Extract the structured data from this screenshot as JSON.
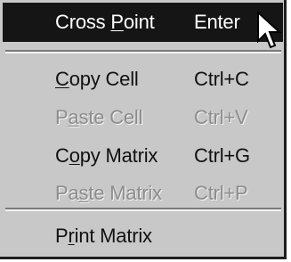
{
  "menu": {
    "items": [
      {
        "pre": "Cross ",
        "mnemonic": "P",
        "post": "oint",
        "accelerator": "Enter"
      },
      {
        "pre": "",
        "mnemonic": "C",
        "post": "opy Cell",
        "accelerator": "Ctrl+C"
      },
      {
        "pre": "P",
        "mnemonic": "a",
        "post": "ste Cell",
        "accelerator": "Ctrl+V"
      },
      {
        "pre": "C",
        "mnemonic": "o",
        "post": "py Matrix",
        "accelerator": "Ctrl+G"
      },
      {
        "pre": "Pa",
        "mnemonic": "s",
        "post": "te Matrix",
        "accelerator": "Ctrl+P"
      },
      {
        "pre": "P",
        "mnemonic": "r",
        "post": "int Matrix",
        "accelerator": ""
      }
    ]
  },
  "colors": {
    "menu_background": "#c8c8c8",
    "highlight_background": "#151515",
    "highlight_text": "#ffffff",
    "disabled_text": "#8c8c8c"
  },
  "icons": {
    "cursor": "mouse-pointer-arrow-icon"
  }
}
